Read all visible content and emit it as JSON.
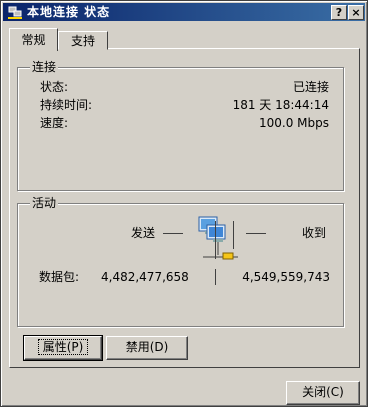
{
  "window": {
    "title": "本地连接 状态",
    "help_label": "?",
    "close_label": "×"
  },
  "tabs": [
    {
      "label": "常规"
    },
    {
      "label": "支持"
    }
  ],
  "connection": {
    "group_label": "连接",
    "rows": [
      {
        "label": "状态:",
        "value": "已连接"
      },
      {
        "label": "持续时间:",
        "value": "181 天 18:44:14"
      },
      {
        "label": "速度:",
        "value": "100.0 Mbps"
      }
    ]
  },
  "activity": {
    "group_label": "活动",
    "sent_label": "发送",
    "received_label": "收到",
    "packets_label": "数据包:",
    "sent_packets": "4,482,477,658",
    "received_packets": "4,549,559,743",
    "icon": "network-computers-icon"
  },
  "buttons": {
    "properties": "属性(P)",
    "disable": "禁用(D)",
    "close": "关闭(C)"
  }
}
